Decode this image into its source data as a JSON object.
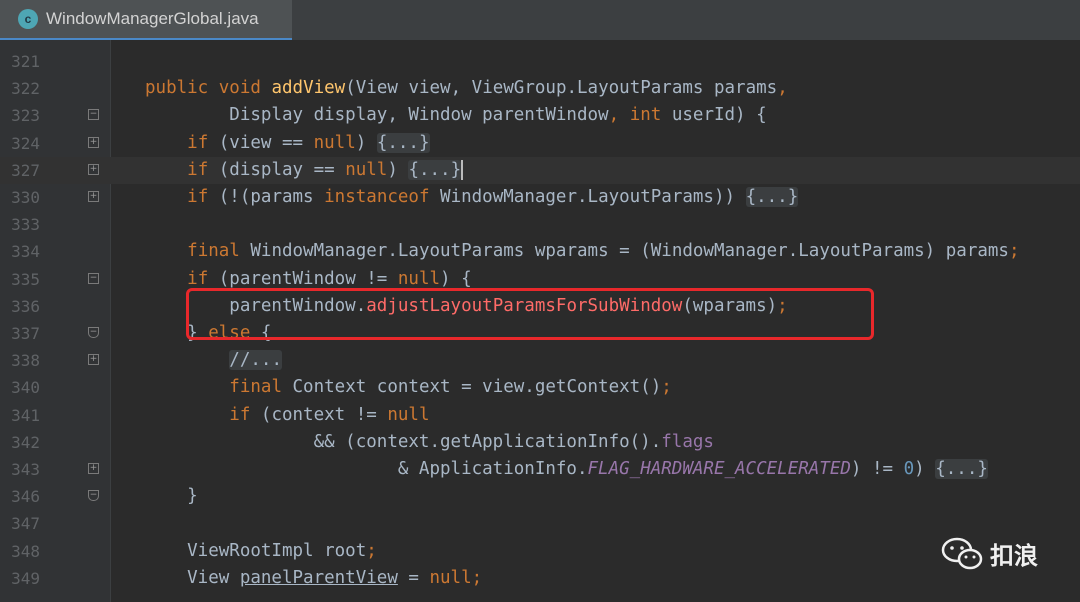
{
  "tab": {
    "icon_letter": "c",
    "title": "WindowManagerGlobal.java",
    "close": "×"
  },
  "editor": {
    "lines": [
      {
        "n": "321",
        "fold": "",
        "tokens": []
      },
      {
        "n": "322",
        "fold": "",
        "tokens": [
          {
            "t": "public",
            "c": "kw"
          },
          {
            "t": " "
          },
          {
            "t": "void",
            "c": "kw"
          },
          {
            "t": " "
          },
          {
            "t": "addView",
            "c": "fn"
          },
          {
            "t": "(View view, ViewGroup.LayoutParams params"
          },
          {
            "t": ",",
            "c": "kw"
          }
        ]
      },
      {
        "n": "323",
        "fold": "start",
        "tokens": [
          {
            "t": "        Display display, Window parentWindow"
          },
          {
            "t": ",",
            "c": "kw"
          },
          {
            "t": " "
          },
          {
            "t": "int",
            "c": "kw"
          },
          {
            "t": " userId) {"
          }
        ]
      },
      {
        "n": "324",
        "fold": "plus",
        "tokens": [
          {
            "t": "    "
          },
          {
            "t": "if",
            "c": "kw"
          },
          {
            "t": " (view == "
          },
          {
            "t": "null",
            "c": "kw"
          },
          {
            "t": ") "
          },
          {
            "t": "{...}",
            "c": "fold-ph"
          }
        ]
      },
      {
        "n": "327",
        "fold": "plus",
        "caret": true,
        "tokens": [
          {
            "t": "    "
          },
          {
            "t": "if",
            "c": "kw"
          },
          {
            "t": " (display == "
          },
          {
            "t": "null",
            "c": "kw"
          },
          {
            "t": ") "
          },
          {
            "t": "{...}",
            "c": "fold-ph"
          },
          {
            "t": "",
            "c": "caret"
          }
        ]
      },
      {
        "n": "330",
        "fold": "plus",
        "tokens": [
          {
            "t": "    "
          },
          {
            "t": "if",
            "c": "kw"
          },
          {
            "t": " (!(params "
          },
          {
            "t": "instanceof",
            "c": "kw"
          },
          {
            "t": " WindowManager.LayoutParams)) "
          },
          {
            "t": "{...}",
            "c": "fold-ph"
          }
        ]
      },
      {
        "n": "333",
        "fold": "",
        "tokens": []
      },
      {
        "n": "334",
        "fold": "",
        "tokens": [
          {
            "t": "    "
          },
          {
            "t": "final",
            "c": "kw"
          },
          {
            "t": " WindowManager.LayoutParams wparams = (WindowManager.LayoutParams) params"
          },
          {
            "t": ";",
            "c": "kw"
          }
        ]
      },
      {
        "n": "335",
        "fold": "start",
        "tokens": [
          {
            "t": "    "
          },
          {
            "t": "if",
            "c": "kw"
          },
          {
            "t": " (parentWindow != "
          },
          {
            "t": "null",
            "c": "kw"
          },
          {
            "t": ") {"
          }
        ]
      },
      {
        "n": "336",
        "fold": "",
        "tokens": [
          {
            "t": "        parentWindow."
          },
          {
            "t": "adjustLayoutParamsForSubWindow",
            "c": "mc"
          },
          {
            "t": "(wparams)"
          },
          {
            "t": ";",
            "c": "kw"
          }
        ]
      },
      {
        "n": "337",
        "fold": "end",
        "tokens": [
          {
            "t": "    } "
          },
          {
            "t": "else",
            "c": "kw"
          },
          {
            "t": " {"
          }
        ]
      },
      {
        "n": "338",
        "fold": "plus",
        "tokens": [
          {
            "t": "        "
          },
          {
            "t": "//...",
            "c": "cm fold-ph"
          }
        ]
      },
      {
        "n": "340",
        "fold": "",
        "tokens": [
          {
            "t": "        "
          },
          {
            "t": "final",
            "c": "kw"
          },
          {
            "t": " Context context = view.getContext()"
          },
          {
            "t": ";",
            "c": "kw"
          }
        ]
      },
      {
        "n": "341",
        "fold": "",
        "tokens": [
          {
            "t": "        "
          },
          {
            "t": "if",
            "c": "kw"
          },
          {
            "t": " (context != "
          },
          {
            "t": "null",
            "c": "kw"
          }
        ]
      },
      {
        "n": "342",
        "fold": "",
        "tokens": [
          {
            "t": "                && (context.getApplicationInfo()."
          },
          {
            "t": "flags",
            "c": "fld"
          }
        ]
      },
      {
        "n": "343",
        "fold": "plus",
        "tokens": [
          {
            "t": "                        & ApplicationInfo."
          },
          {
            "t": "FLAG_HARDWARE_ACCELERATED",
            "c": "const"
          },
          {
            "t": ") != "
          },
          {
            "t": "0",
            "c": "num"
          },
          {
            "t": ") "
          },
          {
            "t": "{...}",
            "c": "fold-ph"
          }
        ]
      },
      {
        "n": "346",
        "fold": "end",
        "tokens": [
          {
            "t": "    }"
          }
        ]
      },
      {
        "n": "347",
        "fold": "",
        "tokens": []
      },
      {
        "n": "348",
        "fold": "",
        "tokens": [
          {
            "t": "    ViewRootImpl root"
          },
          {
            "t": ";",
            "c": "kw"
          }
        ]
      },
      {
        "n": "349",
        "fold": "",
        "tokens": [
          {
            "t": "    View "
          },
          {
            "t": "panelParentView",
            "c": "underline"
          },
          {
            "t": " = "
          },
          {
            "t": "null",
            "c": "kw"
          },
          {
            "t": ";",
            "c": "kw"
          }
        ]
      }
    ]
  },
  "watermark": {
    "text": "扣浪",
    "icon": "wechat-icon"
  }
}
